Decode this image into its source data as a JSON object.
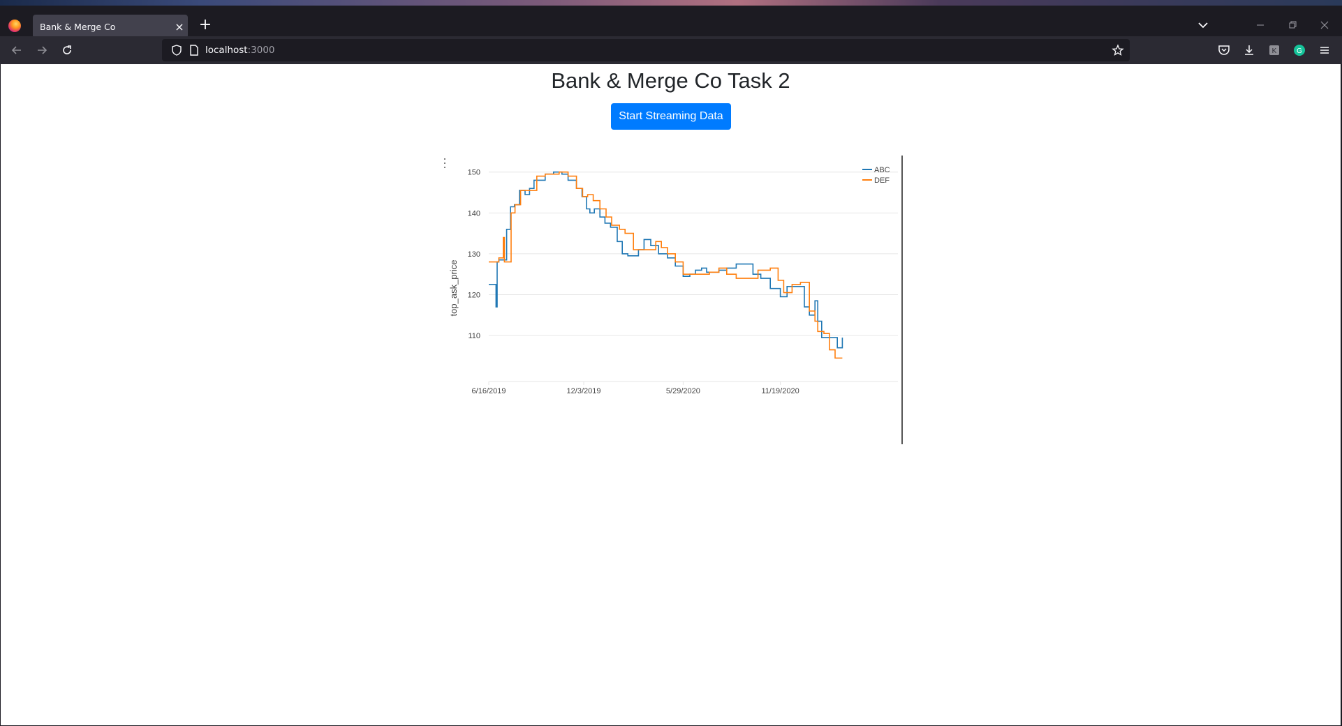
{
  "browser": {
    "tab_title": "Bank & Merge Co",
    "tab_close": "×",
    "new_tab": "+",
    "url_host": "localhost",
    "url_port": ":3000"
  },
  "page": {
    "title": "Bank & Merge Co Task 2",
    "stream_button": "Start Streaming Data"
  },
  "icons": [
    "firefox-logo",
    "close-icon",
    "plus-icon",
    "chevron-down-icon",
    "minimize-icon",
    "restore-icon",
    "close-window-icon",
    "back-icon",
    "forward-icon",
    "reload-icon",
    "shield-icon",
    "page-icon",
    "star-icon",
    "pocket-icon",
    "download-icon",
    "extension-icon",
    "grammarly-icon",
    "menu-icon",
    "chart-menu-icon"
  ],
  "chart_data": {
    "type": "line",
    "ylabel": "top_ask_price",
    "xlabel": "",
    "x_ticks": [
      "6/16/2019",
      "12/3/2019",
      "5/29/2020",
      "11/19/2020"
    ],
    "y_ticks": [
      "110",
      "120",
      "130",
      "140",
      "150"
    ],
    "ylim": [
      102,
      152
    ],
    "grid": true,
    "legend_position": "top-right",
    "colors": {
      "ABC": "#1f77b4",
      "DEF": "#ff7f0e"
    },
    "series": [
      {
        "name": "ABC",
        "x": [
          "2019-06-16",
          "2019-06-23",
          "2019-06-29",
          "2019-07-01",
          "2019-07-04",
          "2019-07-18",
          "2019-07-25",
          "2019-08-01",
          "2019-08-10",
          "2019-08-20",
          "2019-08-28",
          "2019-09-05",
          "2019-09-15",
          "2019-09-25",
          "2019-10-10",
          "2019-10-25",
          "2019-11-05",
          "2019-11-20",
          "2019-11-30",
          "2019-12-08",
          "2019-12-14",
          "2019-12-22",
          "2020-01-01",
          "2020-01-10",
          "2020-01-20",
          "2020-02-01",
          "2020-02-10",
          "2020-02-20",
          "2020-03-01",
          "2020-03-10",
          "2020-03-20",
          "2020-04-01",
          "2020-04-15",
          "2020-05-01",
          "2020-05-15",
          "2020-05-29",
          "2020-06-10",
          "2020-06-20",
          "2020-07-01",
          "2020-07-10",
          "2020-07-20",
          "2020-08-01",
          "2020-08-15",
          "2020-09-01",
          "2020-09-15",
          "2020-10-01",
          "2020-10-15",
          "2020-11-01",
          "2020-11-19",
          "2020-12-01",
          "2020-12-10",
          "2021-01-01",
          "2021-01-10",
          "2021-01-20",
          "2021-01-25",
          "2021-02-01",
          "2021-02-20",
          "2021-03-01",
          "2021-03-10"
        ],
        "values": [
          122.5,
          122.5,
          117,
          128,
          128.5,
          136,
          141.5,
          142,
          145.5,
          144.5,
          146,
          148,
          148,
          149.5,
          150,
          149.5,
          148,
          146,
          144,
          141,
          140,
          141,
          139,
          137.5,
          136.5,
          133,
          130,
          129.5,
          129.5,
          131,
          133.5,
          132,
          130,
          129,
          127,
          124.5,
          125,
          126,
          126.5,
          125.5,
          125.5,
          126,
          126.5,
          127.5,
          127.5,
          125,
          124,
          121.5,
          119.5,
          122,
          122,
          117,
          115,
          118.5,
          113.5,
          109.5,
          109.5,
          107,
          109.5
        ]
      },
      {
        "name": "DEF",
        "x": [
          "2019-06-16",
          "2019-06-28",
          "2019-07-04",
          "2019-07-12",
          "2019-07-14",
          "2019-07-20",
          "2019-07-26",
          "2019-08-02",
          "2019-08-12",
          "2019-08-25",
          "2019-09-10",
          "2019-09-25",
          "2019-10-20",
          "2019-11-05",
          "2019-11-20",
          "2019-12-01",
          "2019-12-10",
          "2019-12-20",
          "2020-01-01",
          "2020-01-12",
          "2020-01-22",
          "2020-02-05",
          "2020-02-15",
          "2020-03-01",
          "2020-03-15",
          "2020-04-01",
          "2020-04-10",
          "2020-04-20",
          "2020-05-01",
          "2020-05-15",
          "2020-05-29",
          "2020-06-15",
          "2020-07-01",
          "2020-07-15",
          "2020-08-01",
          "2020-08-15",
          "2020-09-01",
          "2020-09-20",
          "2020-10-10",
          "2020-10-20",
          "2020-11-01",
          "2020-11-15",
          "2020-11-25",
          "2020-12-10",
          "2020-12-25",
          "2021-01-10",
          "2021-01-20",
          "2021-01-25",
          "2021-02-05",
          "2021-02-15",
          "2021-02-25",
          "2021-03-10"
        ],
        "values": [
          128,
          128,
          129,
          134,
          128,
          128,
          140,
          142,
          145.5,
          145.5,
          149,
          149.5,
          150,
          149,
          146,
          144,
          144.5,
          143,
          141,
          139,
          137,
          136,
          135,
          131,
          131,
          131,
          133,
          131.5,
          130,
          128,
          125,
          125,
          125,
          125.5,
          126.5,
          125,
          124,
          124,
          126,
          126,
          126.5,
          123.5,
          120.5,
          122.5,
          123,
          116,
          113.5,
          111,
          110.5,
          106.5,
          104.5,
          104.5
        ]
      }
    ]
  }
}
